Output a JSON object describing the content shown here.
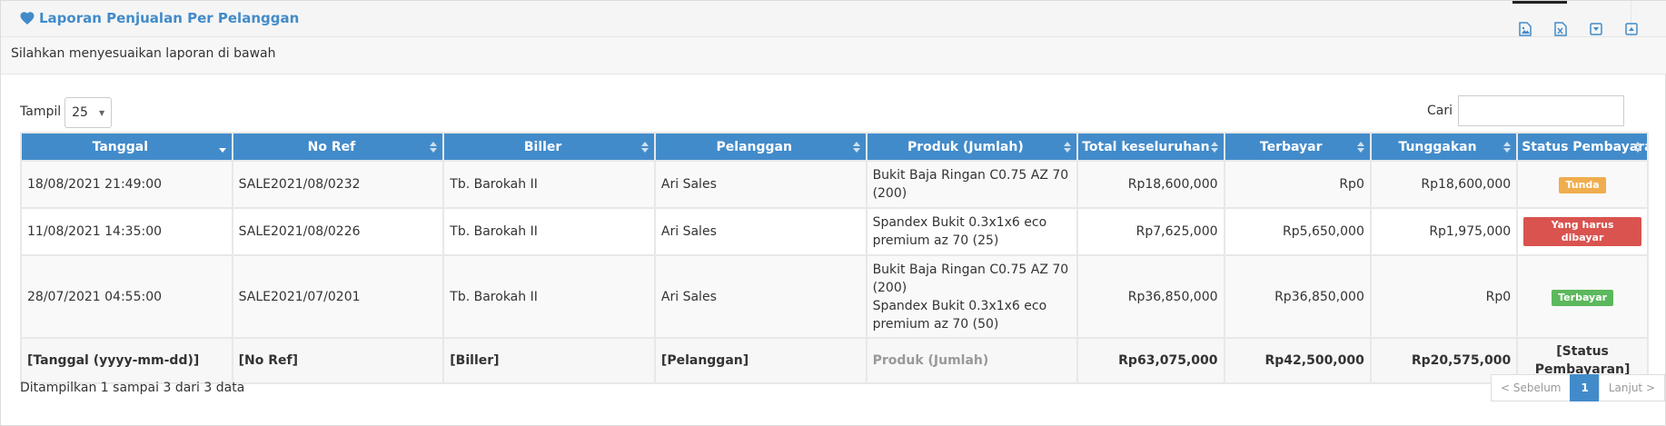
{
  "header": {
    "title": "Laporan Penjualan Per Pelanggan",
    "accent_color": "#428bca",
    "tool_icons": [
      "image-export-icon",
      "excel-export-icon",
      "collapse-down-icon",
      "expand-up-icon"
    ]
  },
  "intro_text": "Silahkan menyesuaikan laporan di bawah",
  "controls": {
    "length_label": "Tampil",
    "length_value": "25",
    "search_label": "Cari",
    "search_value": ""
  },
  "table": {
    "columns": [
      "Tanggal",
      "No Ref",
      "Biller",
      "Pelanggan",
      "Produk (Jumlah)",
      "Total keseluruhan",
      "Terbayar",
      "Tunggakan",
      "Status Pembayaran"
    ],
    "rows": [
      {
        "tanggal": "18/08/2021 21:49:00",
        "no_ref": "SALE2021/08/0232",
        "biller": "Tb. Barokah II",
        "pelanggan": "Ari Sales",
        "produk_1": "Bukit Baja Ringan C0.75 AZ 70 (200)",
        "produk_2": "",
        "total": "Rp18,600,000",
        "terbayar": "Rp0",
        "tunggakan": "Rp18,600,000",
        "status": "Tunda",
        "status_color": "#f0ad4e"
      },
      {
        "tanggal": "11/08/2021 14:35:00",
        "no_ref": "SALE2021/08/0226",
        "biller": "Tb. Barokah II",
        "pelanggan": "Ari Sales",
        "produk_1": "Spandex Bukit 0.3x1x6 eco premium az 70 (25)",
        "produk_2": "",
        "total": "Rp7,625,000",
        "terbayar": "Rp5,650,000",
        "tunggakan": "Rp1,975,000",
        "status": "Yang harus dibayar",
        "status_color": "#d9534f"
      },
      {
        "tanggal": "28/07/2021 04:55:00",
        "no_ref": "SALE2021/07/0201",
        "biller": "Tb. Barokah II",
        "pelanggan": "Ari Sales",
        "produk_1": "Bukit Baja Ringan C0.75 AZ 70 (200)",
        "produk_2": "Spandex Bukit 0.3x1x6 eco premium az 70 (50)",
        "total": "Rp36,850,000",
        "terbayar": "Rp36,850,000",
        "tunggakan": "Rp0",
        "status": "Terbayar",
        "status_color": "#5cb85c"
      }
    ],
    "footer": {
      "tanggal": "[Tanggal (yyyy-mm-dd)]",
      "no_ref": "[No Ref]",
      "biller": "[Biller]",
      "pelanggan": "[Pelanggan]",
      "produk": "Produk (Jumlah)",
      "total": "Rp63,075,000",
      "terbayar": "Rp42,500,000",
      "tunggakan": "Rp20,575,000",
      "status": "[Status Pembayaran]"
    }
  },
  "info_text": "Ditampilkan 1 sampai 3 dari 3 data",
  "pagination": {
    "prev": "< Sebelum",
    "current": "1",
    "next": "Lanjut >"
  }
}
